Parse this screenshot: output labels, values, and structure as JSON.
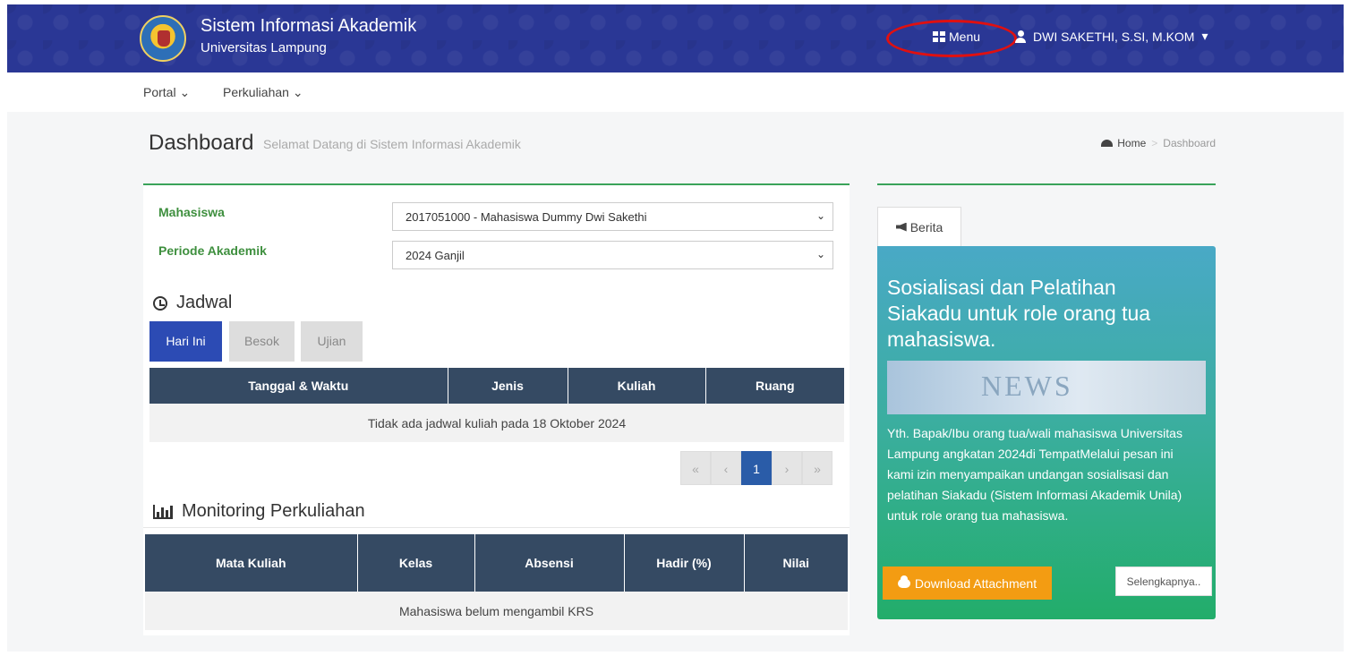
{
  "header": {
    "title": "Sistem Informasi Akademik",
    "subtitle": "Universitas Lampung",
    "menu_label": "Menu",
    "user_name": "DWI SAKETHI, S.SI, M.KOM",
    "user_caret": "▾",
    "menu_icon": "grid-icon",
    "user_icon": "user-icon"
  },
  "nav": {
    "items": [
      {
        "label": "Portal",
        "caret": "⌄"
      },
      {
        "label": "Perkuliahan",
        "caret": "⌄"
      }
    ]
  },
  "page": {
    "title": "Dashboard",
    "subtitle": "Selamat Datang di Sistem Informasi Akademik",
    "breadcrumb": [
      "Home",
      ">",
      "Dashboard"
    ]
  },
  "form": {
    "mahasiswa_label": "Mahasiswa",
    "mahasiswa_value": "2017051000 - Mahasiswa Dummy Dwi Sakethi",
    "periode_label": "Periode Akademik",
    "periode_value": "2024 Ganjil",
    "chevron": "⌄"
  },
  "jadwal": {
    "title": "Jadwal",
    "tabs": [
      "Hari Ini",
      "Besok",
      "Ujian"
    ],
    "active_tab": "Hari Ini",
    "columns": [
      "Tanggal & Waktu",
      "Jenis",
      "Kuliah",
      "Ruang"
    ],
    "empty_message": "Tidak ada jadwal kuliah pada 18 Oktober 2024",
    "pagination": [
      "«",
      "‹",
      "1",
      "›",
      "»"
    ],
    "current_page": "1"
  },
  "monitoring": {
    "title": "Monitoring Perkuliahan",
    "columns": [
      "Mata Kuliah",
      "Kelas",
      "Absensi",
      "Hadir (%)",
      "Nilai"
    ],
    "empty_message": "Mahasiswa belum mengambil KRS"
  },
  "berita": {
    "tab_label": "Berita",
    "news_title": "Sosialisasi dan Pelatihan Siakadu untuk role orang tua mahasiswa.",
    "image_text": "NEWS",
    "body": "Yth. Bapak/Ibu orang tua/wali mahasiswa Universitas Lampung angkatan 2024di TempatMelalui pesan ini kami izin menyampaikan undangan sosialisasi dan pelatihan Siakadu (Sistem Informasi Akademik Unila) untuk role orang tua mahasiswa.",
    "download_label": "Download Attachment",
    "more_label": "Selengkapnya.."
  },
  "colors": {
    "header_bg": "#2a3795",
    "accent_green": "#3aa35a",
    "tab_active": "#2c4bb4",
    "table_header": "#354a63",
    "download_btn": "#f39c12",
    "annotation_red": "#e01010"
  }
}
